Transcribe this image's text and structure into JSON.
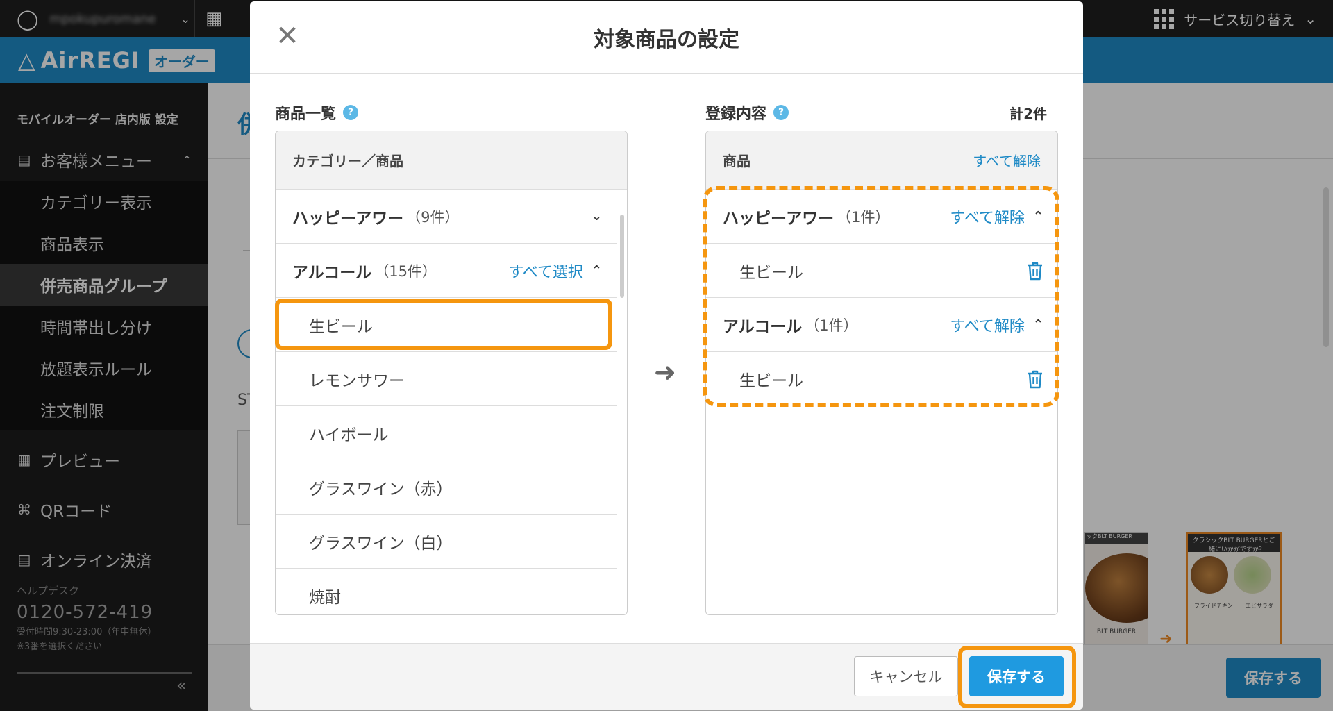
{
  "topbar": {
    "user_name": "mpokupuromane",
    "service_switch_label": "サービス切り替え"
  },
  "brand": {
    "name": "AirREGI",
    "tag": "オーダー"
  },
  "sidebar": {
    "section_title": "モバイルオーダー 店内版 設定",
    "menu_group_label": "お客様メニュー",
    "sub_items": [
      {
        "label": "カテゴリー表示"
      },
      {
        "label": "商品表示"
      },
      {
        "label": "併売商品グループ",
        "active": true
      },
      {
        "label": "時間帯出し分け"
      },
      {
        "label": "放題表示ルール"
      },
      {
        "label": "注文制限"
      }
    ],
    "items": [
      {
        "label": "プレビュー"
      },
      {
        "label": "QRコード"
      },
      {
        "label": "オンライン決済"
      }
    ],
    "help": {
      "label": "ヘルプデスク",
      "phone": "0120-572-419",
      "hours": "受付時間9:30-23:00（年中無休）",
      "note": "※3番を選択ください"
    }
  },
  "background": {
    "title_fragment": "併",
    "st_fragment": "ST",
    "save_label": "保存する",
    "thumb1_caption": "BLT BURGER",
    "thumb1_header": "ックBLT BURGER",
    "thumb2_header": "クラシックBLT BURGERとご一緒にいかがですか？",
    "thumb2_item_1": "フライドチキン",
    "thumb2_item_2": "エビサラダ"
  },
  "modal": {
    "title": "対象商品の設定",
    "left": {
      "label": "商品一覧",
      "header": "カテゴリー／商品",
      "categories": [
        {
          "name": "ハッピーアワー",
          "count": "（9件）",
          "expanded": false
        },
        {
          "name": "アルコール",
          "count": "（15件）",
          "expanded": true,
          "action": "すべて選択"
        }
      ],
      "items": [
        "生ビール",
        "レモンサワー",
        "ハイボール",
        "グラスワイン（赤）",
        "グラスワイン（白）",
        "焼酎"
      ]
    },
    "right": {
      "label": "登録内容",
      "total": "計2件",
      "header": "商品",
      "clear_all": "すべて解除",
      "groups": [
        {
          "name": "ハッピーアワー",
          "count": "（1件）",
          "action": "すべて解除",
          "items": [
            "生ビール"
          ]
        },
        {
          "name": "アルコール",
          "count": "（1件）",
          "action": "すべて解除",
          "items": [
            "生ビール"
          ]
        }
      ]
    },
    "cancel_label": "キャンセル",
    "save_label": "保存する"
  },
  "colors": {
    "accent": "#1f8ac6",
    "highlight": "#f5960f",
    "dark": "#1c1c1c"
  }
}
